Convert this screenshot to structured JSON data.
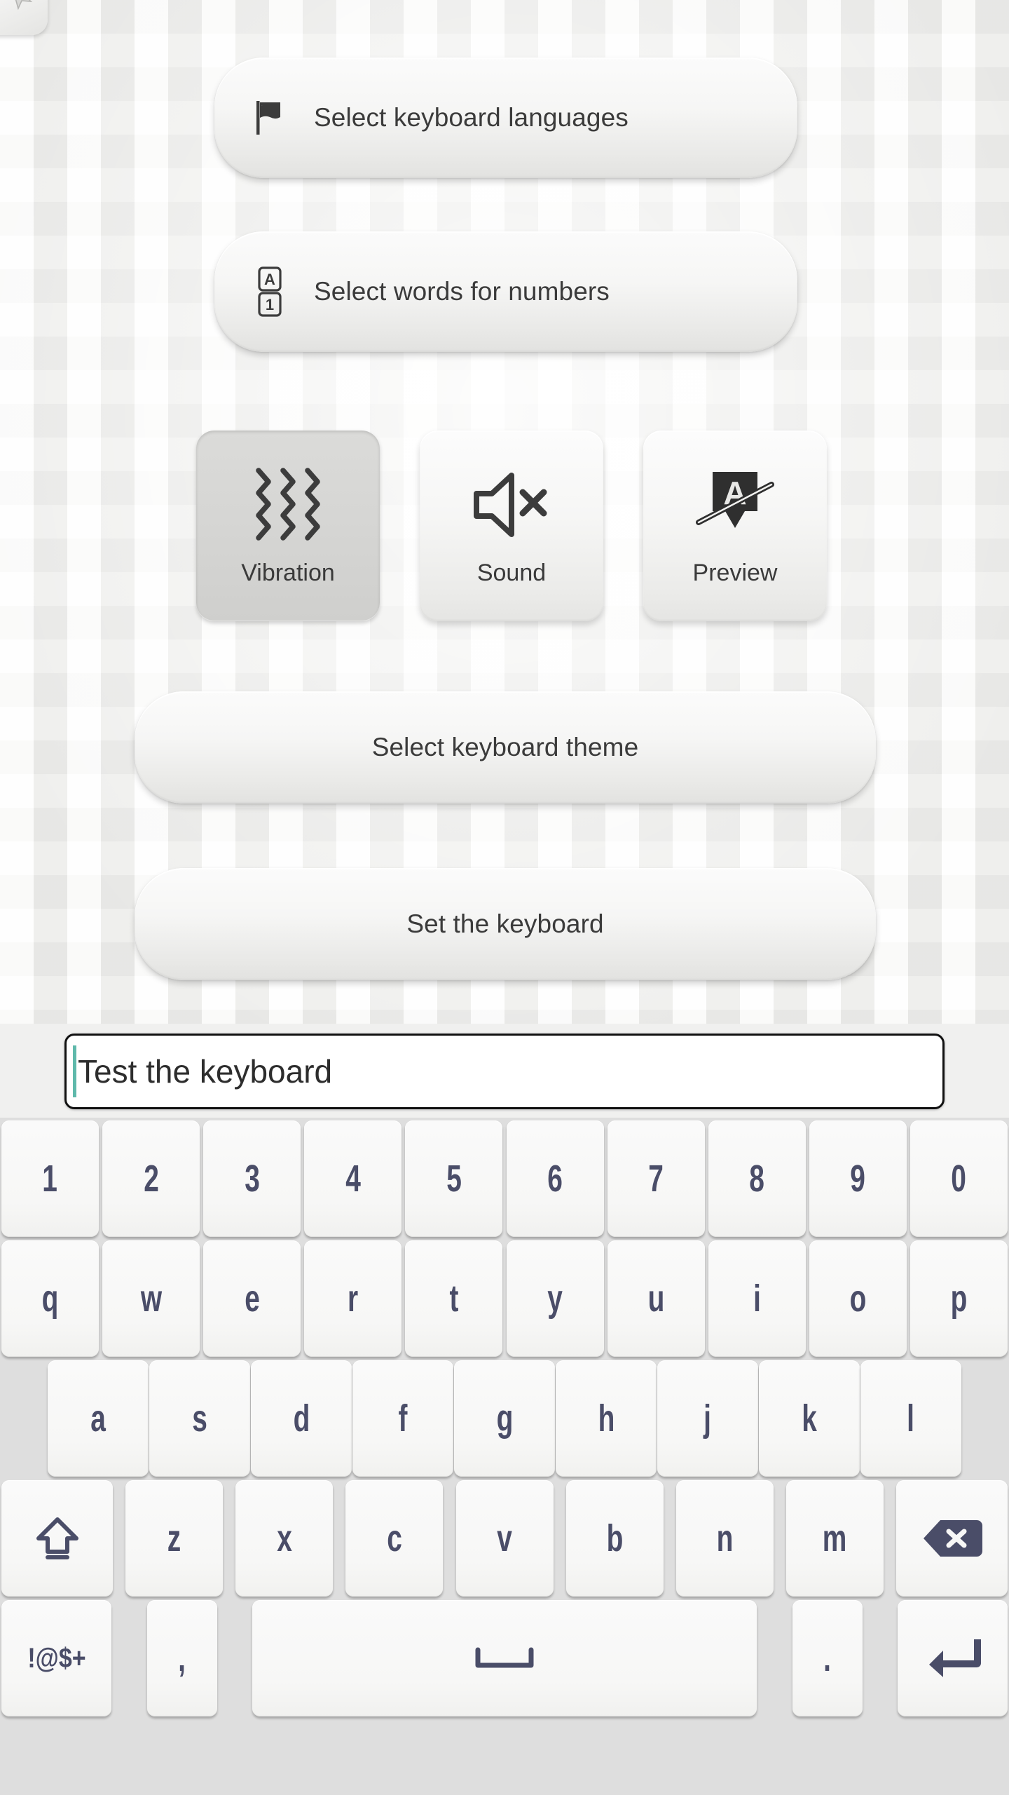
{
  "settings": {
    "languages_button": {
      "label": "Select keyboard languages",
      "icon": "flag-icon"
    },
    "numwords_button": {
      "label": "Select words for numbers",
      "icon": "letter-over-number-icon",
      "icon_top": "A",
      "icon_bottom": "1"
    },
    "tiles": [
      {
        "label": "Vibration",
        "icon": "vibration-waves-icon",
        "active": true
      },
      {
        "label": "Sound",
        "icon": "speaker-muted-icon",
        "active": false
      },
      {
        "label": "Preview",
        "icon": "key-preview-disabled-icon",
        "active": false
      }
    ],
    "theme_button": {
      "label": "Select keyboard theme"
    },
    "set_keyboard_button": {
      "label": "Set the keyboard"
    }
  },
  "test_field": {
    "value": "Test the keyboard",
    "caret_color": "#5fb9ab"
  },
  "keyboard": {
    "key_text_color": "#4a4d68",
    "background_color": "#dedede",
    "rows": [
      {
        "name": "numbers",
        "keys": [
          "1",
          "2",
          "3",
          "4",
          "5",
          "6",
          "7",
          "8",
          "9",
          "0"
        ]
      },
      {
        "name": "qwerty",
        "keys": [
          "q",
          "w",
          "e",
          "r",
          "t",
          "y",
          "u",
          "i",
          "o",
          "p"
        ]
      },
      {
        "name": "asdf",
        "keys": [
          "a",
          "s",
          "d",
          "f",
          "g",
          "h",
          "j",
          "k",
          "l"
        ]
      },
      {
        "name": "zxcv",
        "keys": [
          "shift",
          "z",
          "x",
          "c",
          "v",
          "b",
          "n",
          "m",
          "backspace"
        ]
      },
      {
        "name": "bottom",
        "keys": [
          "!@$+",
          ",",
          "space",
          ".",
          "enter"
        ]
      }
    ],
    "special_keys": {
      "shift": "shift-icon",
      "backspace": "backspace-icon",
      "space": "space-icon",
      "enter": "enter-icon",
      "symbols_label": "!@$+",
      "comma_label": ",",
      "period_label": "."
    }
  }
}
